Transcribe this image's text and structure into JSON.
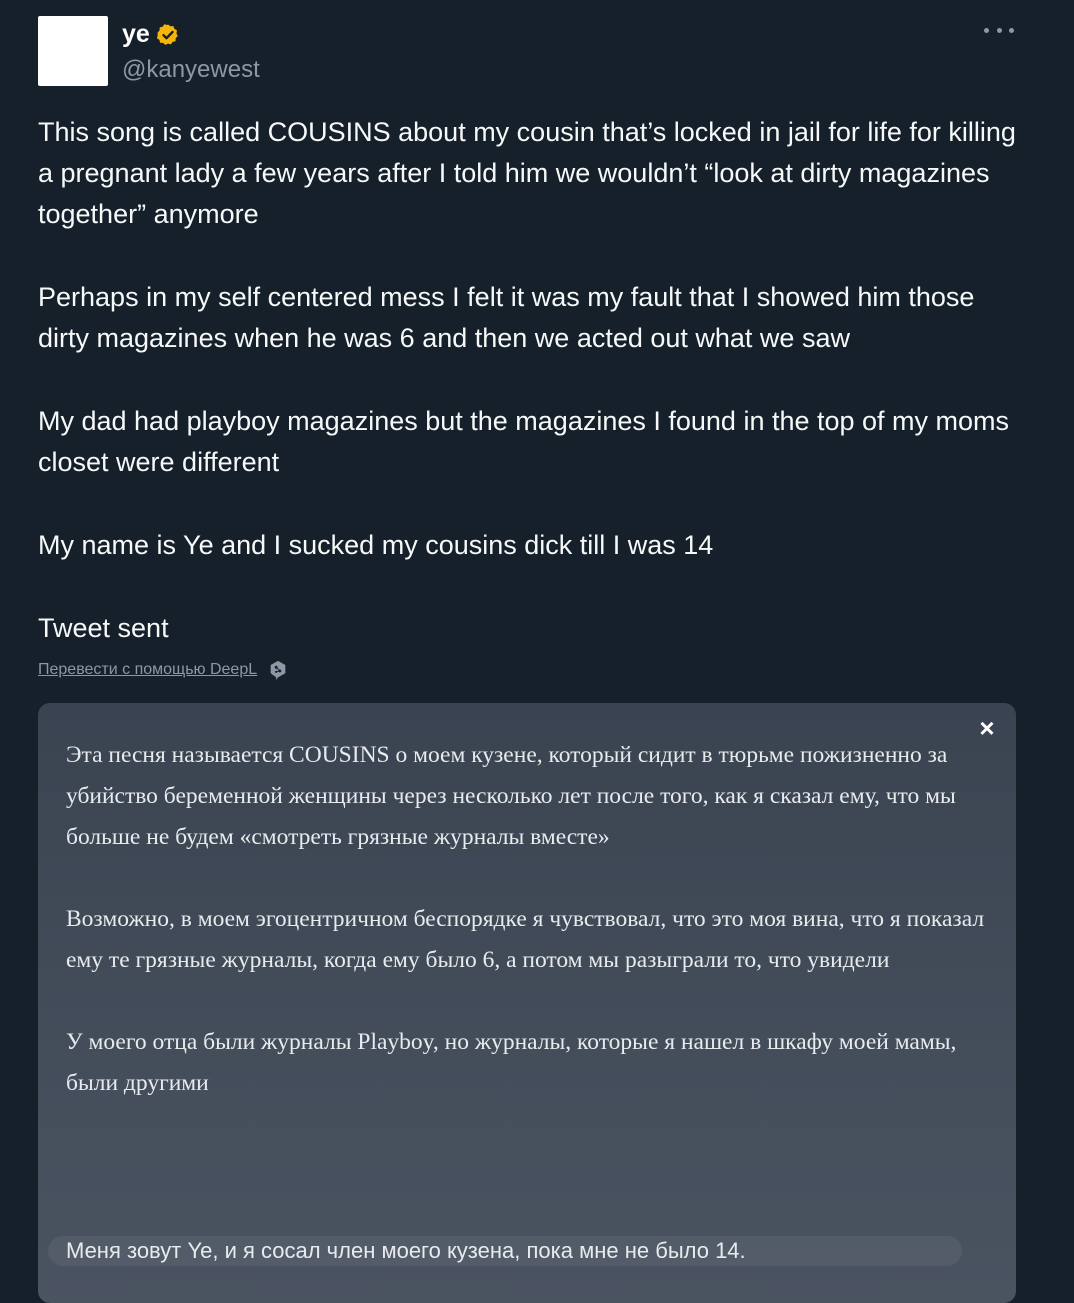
{
  "user": {
    "display_name": "ye",
    "handle": "@kanyewest",
    "verified_color": "#f5b50a"
  },
  "tweet": {
    "paragraphs": [
      "This song is called COUSINS about my cousin that’s locked in jail for life for killing a pregnant lady a few years after I told him we wouldn’t “look at dirty magazines together” anymore",
      "Perhaps in my self centered mess I felt it was my fault that I showed him those dirty magazines when he was 6 and then we acted out what we saw",
      "My dad had playboy magazines but the magazines I found in the top of my moms closet were different",
      "My name is Ye and I sucked my cousins dick till I was 14",
      "Tweet sent"
    ]
  },
  "translate": {
    "link_label": "Перевести с помощью DeepL",
    "close_label": "×",
    "paragraphs": [
      "Эта песня называется COUSINS о моем кузене, который сидит в тюрьме пожизненно за убийство беременной женщины через несколько лет после того, как я сказал ему, что мы больше не будем «смотреть грязные журналы вместе»",
      "Возможно, в моем эгоцентричном беспорядке я чувствовал, что это моя вина, что я показал ему те грязные журналы, когда ему было 6, а потом мы разыграли то, что увидели",
      "У моего отца были журналы Playboy, но журналы, которые я нашел в шкафу моей мамы, были другими"
    ],
    "last_line": "Меня зовут Ye, и я сосал член моего кузена, пока мне не было 14."
  }
}
